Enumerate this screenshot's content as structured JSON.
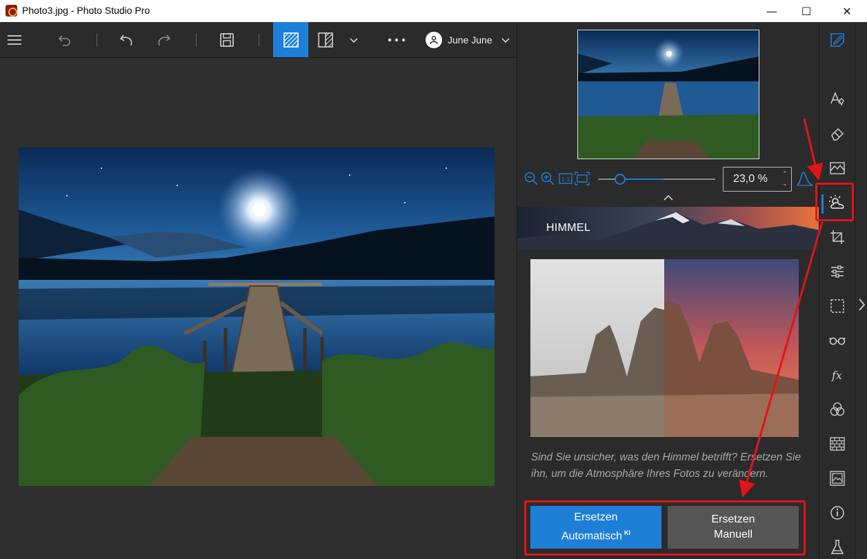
{
  "window": {
    "title": "Photo3.jpg - Photo Studio Pro",
    "controls": {
      "minimize": "—",
      "maximize": "☐",
      "close": "✕"
    }
  },
  "toolbar": {
    "menu_icon": "hamburger-icon",
    "items": [
      "reset-icon",
      "undo-icon",
      "redo-icon",
      "save-icon",
      "single-view-icon",
      "split-view-icon",
      "chevron-down-icon",
      "more-icon"
    ],
    "user_name": "June June"
  },
  "panel": {
    "zoom_value": "23,0 %",
    "zoom_slider_fraction": 0.19,
    "section_title": "HIMMEL",
    "description": "Sind Sie unsicher, was den Himmel betrifft? Ersetzen Sie ihn, um die Atmosphäre Ihres Fotos zu verändern.",
    "button_auto_line1": "Ersetzen",
    "button_auto_line2": "Automatisch",
    "button_auto_badge": "KI",
    "button_manual_line1": "Ersetzen",
    "button_manual_line2": "Manuell"
  },
  "tools": [
    "edit-icon",
    "text-style-icon",
    "eraser-icon",
    "landscape-icon",
    "sky-icon",
    "crop-icon",
    "adjustments-icon",
    "selection-icon",
    "glasses-icon",
    "fx-icon",
    "color-circles-icon",
    "texture-icon",
    "frame-icon",
    "info-icon",
    "lab-icon"
  ],
  "colors": {
    "accent": "#1e7fd6",
    "annotation": "#e3131b",
    "panel_bg": "#2b2b2b"
  }
}
